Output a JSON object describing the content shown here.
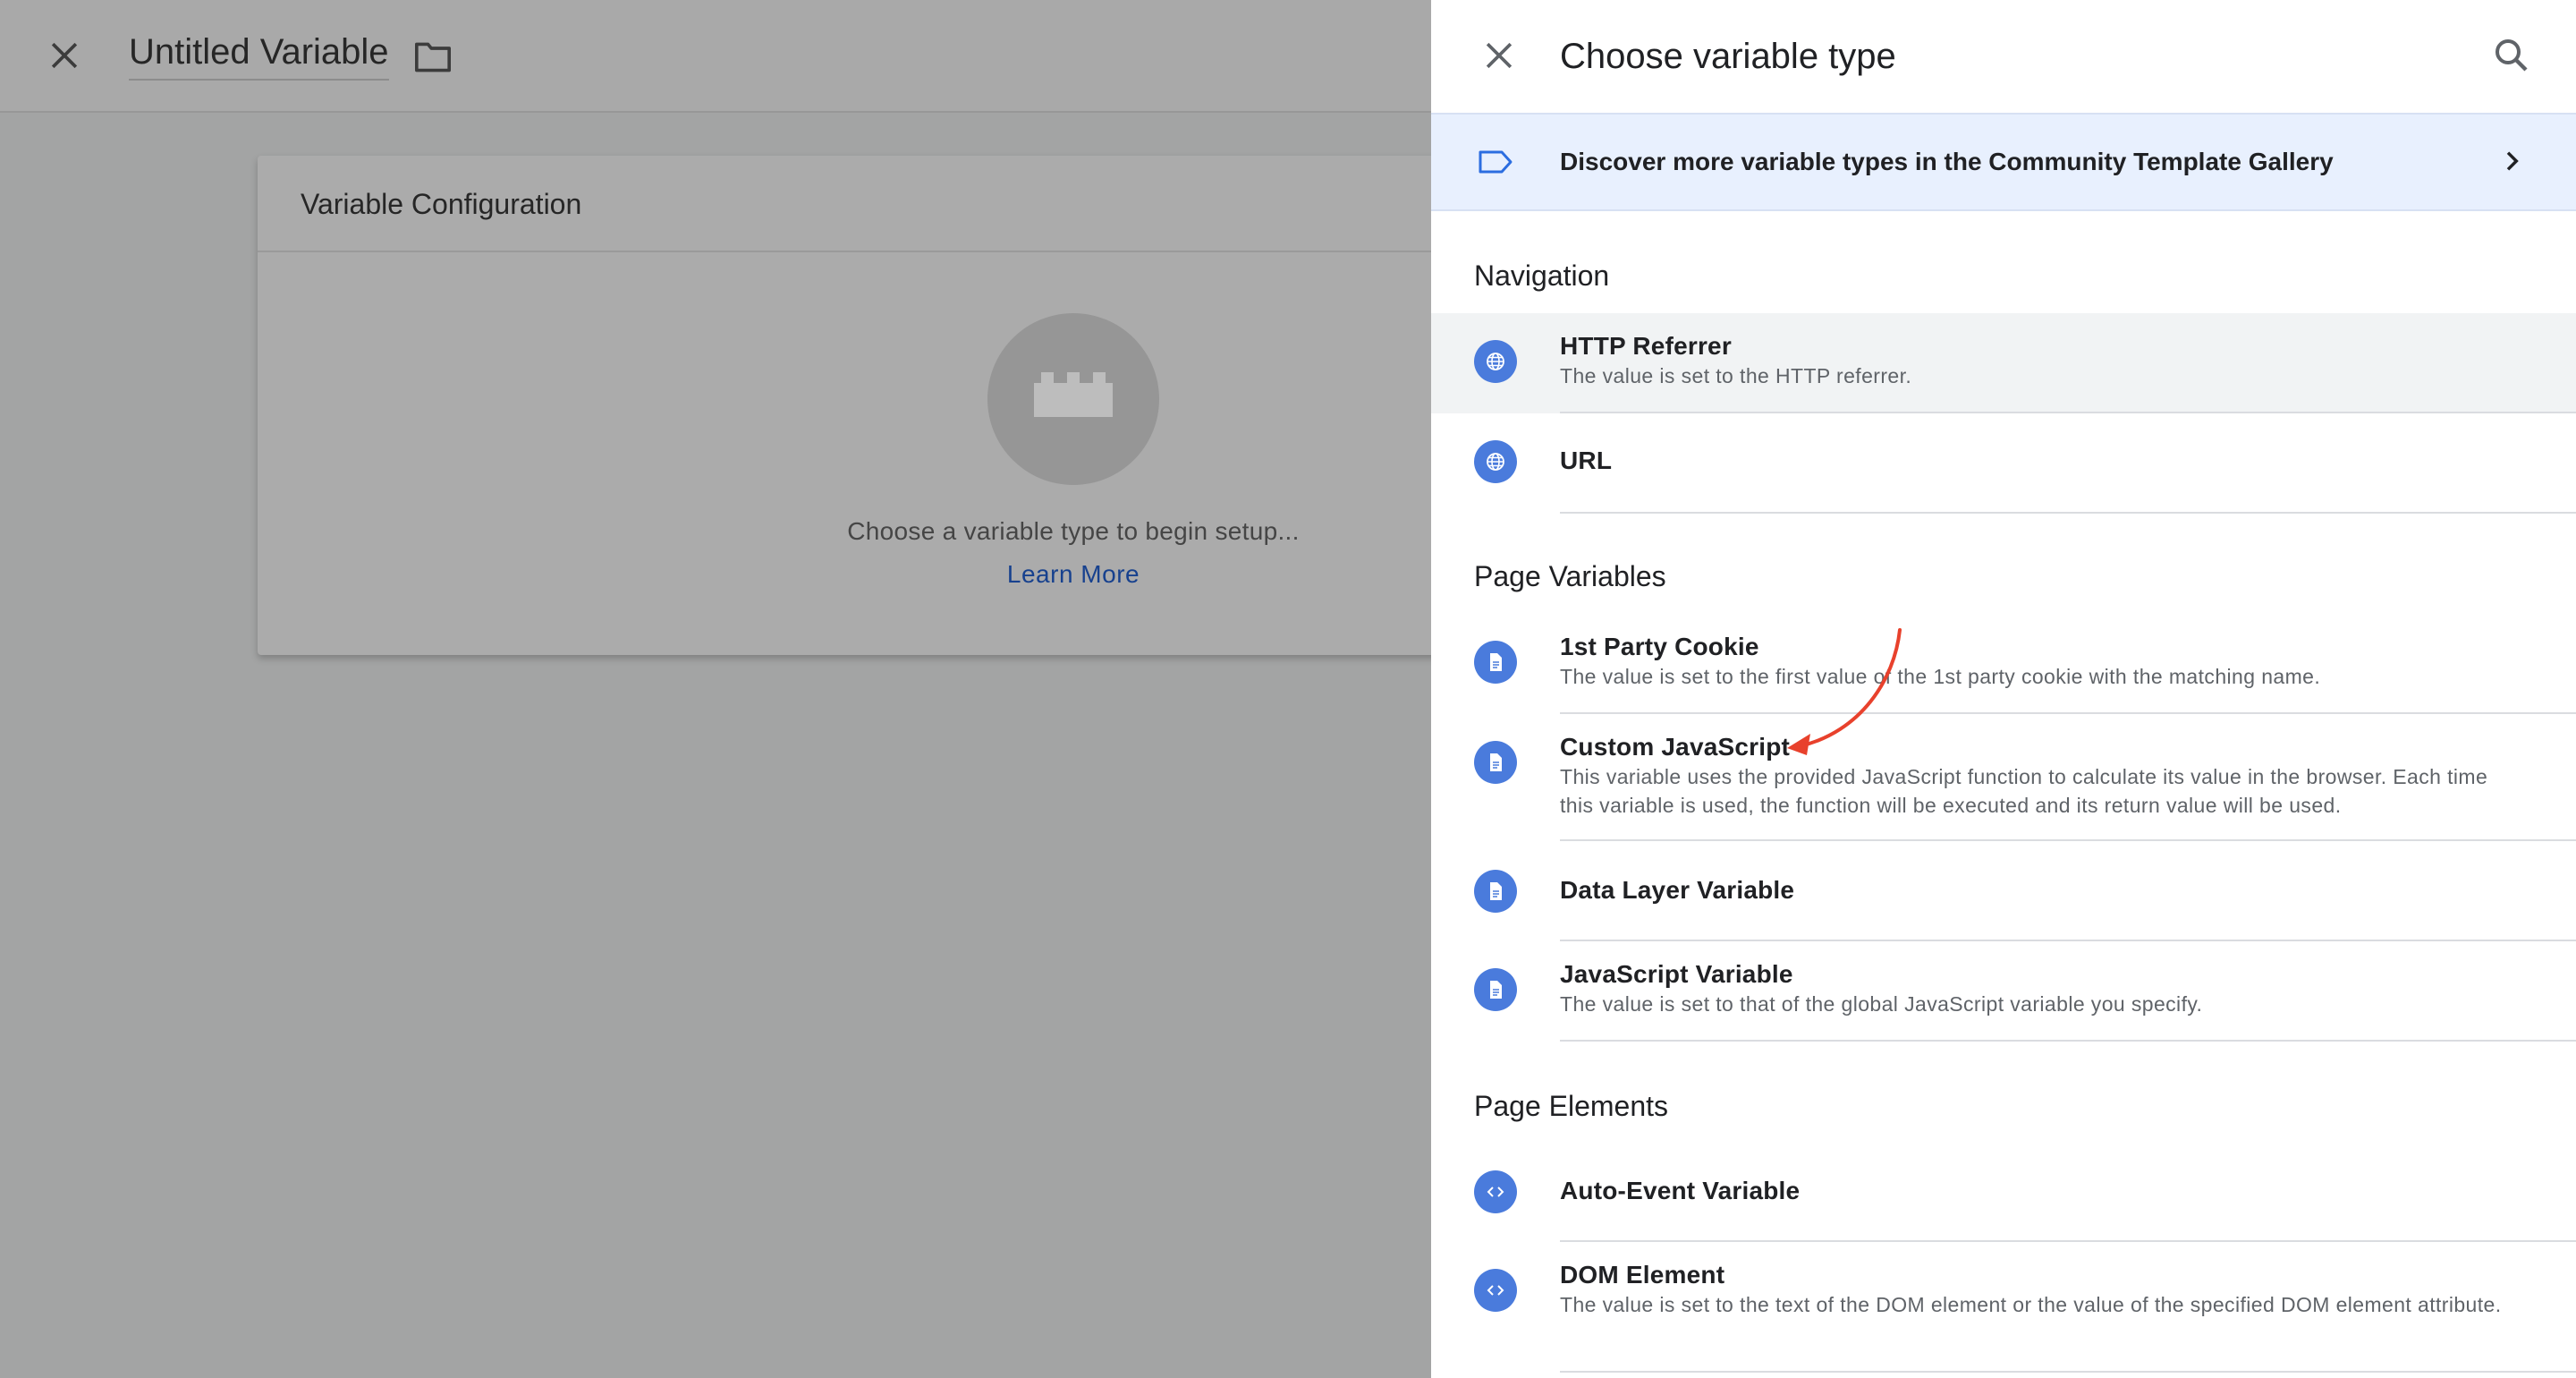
{
  "editor": {
    "title": "Untitled Variable",
    "config_heading": "Variable Configuration",
    "empty_text": "Choose a variable type to begin setup...",
    "learn_more": "Learn More"
  },
  "panel": {
    "title": "Choose variable type",
    "gallery_text": "Discover more variable types in the Community Template Gallery",
    "sections": [
      {
        "heading": "Navigation",
        "items": [
          {
            "title": "HTTP Referrer",
            "desc": "The value is set to the HTTP referrer.",
            "icon": "globe-icon"
          },
          {
            "title": "URL",
            "desc": "",
            "icon": "globe-icon"
          }
        ]
      },
      {
        "heading": "Page Variables",
        "items": [
          {
            "title": "1st Party Cookie",
            "desc": "The value is set to the first value of the 1st party cookie with the matching name.",
            "icon": "document-icon"
          },
          {
            "title": "Custom JavaScript",
            "desc": "This variable uses the provided JavaScript function to calculate its value in the browser. Each time this variable is used, the function will be executed and its return value will be used.",
            "icon": "document-icon"
          },
          {
            "title": "Data Layer Variable",
            "desc": "",
            "icon": "document-icon"
          },
          {
            "title": "JavaScript Variable",
            "desc": "The value is set to that of the global JavaScript variable you specify.",
            "icon": "document-icon"
          }
        ]
      },
      {
        "heading": "Page Elements",
        "items": [
          {
            "title": "Auto-Event Variable",
            "desc": "",
            "icon": "code-icon"
          },
          {
            "title": "DOM Element",
            "desc": "The value is set to the text of the DOM element or the value of the specified DOM element attribute.",
            "icon": "code-icon"
          }
        ]
      }
    ]
  },
  "colors": {
    "accent": "#4a7bdc",
    "banner_bg": "#e8f0fe",
    "annotation_arrow": "#e8412c"
  }
}
